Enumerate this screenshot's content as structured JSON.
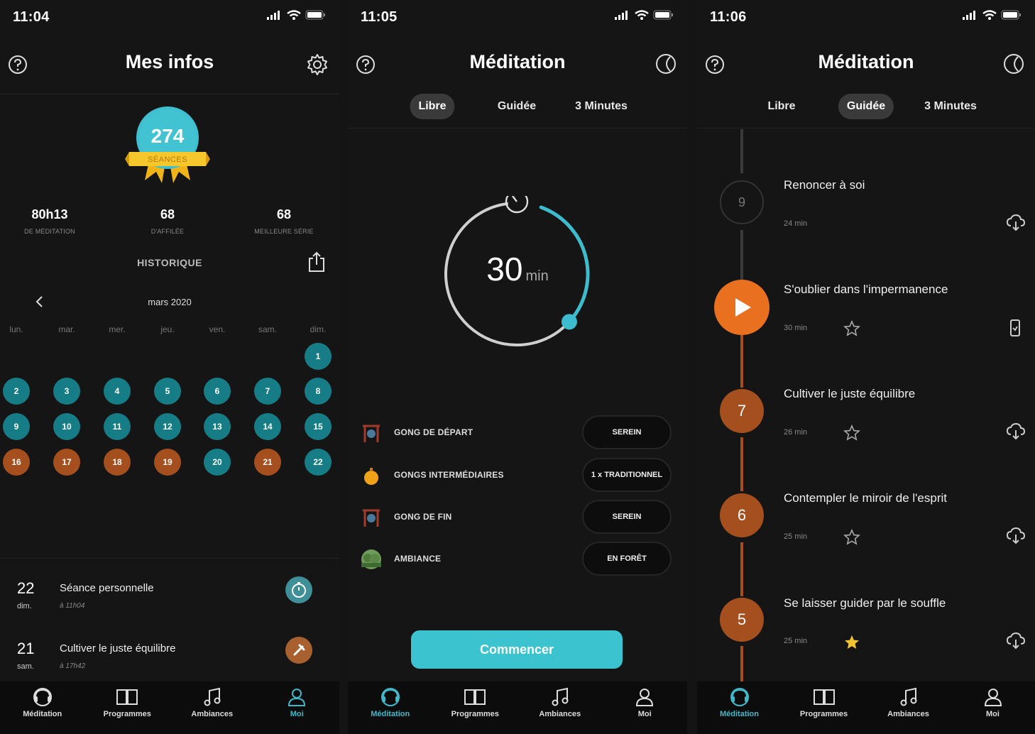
{
  "screens": {
    "info": {
      "time": "11:04",
      "title": "Mes infos",
      "badge": {
        "count": "274",
        "label": "SÉANCES"
      },
      "stats": [
        {
          "value": "80h13",
          "label": "DE MÉDITATION"
        },
        {
          "value": "68",
          "label": "D'AFFILÉE"
        },
        {
          "value": "68",
          "label": "MEILLEURE SÉRIE"
        }
      ],
      "history_title": "HISTORIQUE",
      "month": "mars 2020",
      "weekdays": [
        "lun.",
        "mar.",
        "mer.",
        "jeu.",
        "ven.",
        "sam.",
        "dim."
      ],
      "calendar": [
        {
          "day": "1",
          "status": "teal"
        },
        {
          "day": "2",
          "status": "teal"
        },
        {
          "day": "3",
          "status": "teal"
        },
        {
          "day": "4",
          "status": "teal"
        },
        {
          "day": "5",
          "status": "teal"
        },
        {
          "day": "6",
          "status": "teal"
        },
        {
          "day": "7",
          "status": "teal"
        },
        {
          "day": "8",
          "status": "teal"
        },
        {
          "day": "9",
          "status": "teal"
        },
        {
          "day": "10",
          "status": "teal"
        },
        {
          "day": "11",
          "status": "teal"
        },
        {
          "day": "12",
          "status": "teal"
        },
        {
          "day": "13",
          "status": "teal"
        },
        {
          "day": "14",
          "status": "teal"
        },
        {
          "day": "15",
          "status": "teal"
        },
        {
          "day": "16",
          "status": "orange"
        },
        {
          "day": "17",
          "status": "orange"
        },
        {
          "day": "18",
          "status": "orange"
        },
        {
          "day": "19",
          "status": "orange"
        },
        {
          "day": "20",
          "status": "teal"
        },
        {
          "day": "21",
          "status": "orange"
        },
        {
          "day": "22",
          "status": "teal"
        }
      ],
      "sessions": [
        {
          "num": "22",
          "day": "dim.",
          "title": "Séance personnelle",
          "time": "à 11h04",
          "kind": "timer"
        },
        {
          "num": "21",
          "day": "sam.",
          "title": "Cultiver le juste équilibre",
          "time": "à 17h42",
          "kind": "guided"
        }
      ]
    },
    "libre": {
      "time": "11:05",
      "title": "Méditation",
      "tabs": [
        "Libre",
        "Guidée",
        "3 Minutes"
      ],
      "active_tab": "Libre",
      "timer": {
        "value": "30",
        "unit": "min",
        "progress": 0.4
      },
      "options": [
        {
          "label": "GONG DE DÉPART",
          "value": "SEREIN",
          "icon": "gong-icon"
        },
        {
          "label": "GONGS INTERMÉDIAIRES",
          "value": "1 x TRADITIONNEL",
          "icon": "bell-icon"
        },
        {
          "label": "GONG DE FIN",
          "value": "SEREIN",
          "icon": "gong-icon"
        },
        {
          "label": "AMBIANCE",
          "value": "EN FORÊT",
          "icon": "forest-icon"
        }
      ],
      "start_label": "Commencer"
    },
    "guidee": {
      "time": "11:06",
      "title": "Méditation",
      "tabs": [
        "Libre",
        "Guidée",
        "3 Minutes"
      ],
      "active_tab": "Guidée",
      "items": [
        {
          "num": "9",
          "title": "Renoncer à soi",
          "duration": "24 min",
          "state": "future",
          "starred": null,
          "action": "download"
        },
        {
          "num": "",
          "title": "S'oublier dans l'impermanence",
          "duration": "30 min",
          "state": "play",
          "starred": false,
          "action": "downloaded"
        },
        {
          "num": "7",
          "title": "Cultiver le juste équilibre",
          "duration": "26 min",
          "state": "done",
          "starred": false,
          "action": "download"
        },
        {
          "num": "6",
          "title": "Contempler le miroir de l'esprit",
          "duration": "25 min",
          "state": "done",
          "starred": false,
          "action": "download"
        },
        {
          "num": "5",
          "title": "Se laisser guider par le souffle",
          "duration": "25 min",
          "state": "done",
          "starred": true,
          "action": "download"
        }
      ]
    }
  },
  "nav": [
    "Méditation",
    "Programmes",
    "Ambiances",
    "Moi"
  ],
  "colors": {
    "teal": "#167d87",
    "orange": "#a54f1e",
    "accent": "#3cc3d0",
    "play": "#e8701f",
    "gold": "#f4c430"
  }
}
